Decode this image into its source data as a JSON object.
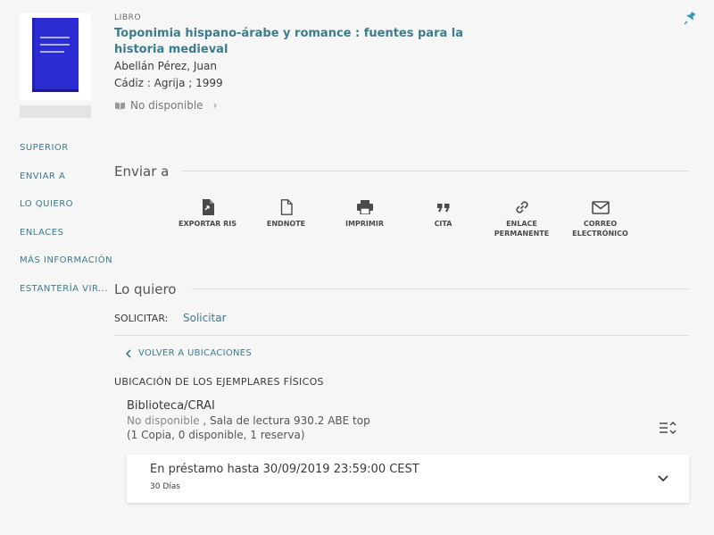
{
  "record": {
    "type": "Libro",
    "title": "Toponimia hispano-árabe y romance : fuentes para la historia medieval",
    "author": "Abellán Pérez, Juan",
    "publisher": "Cádiz : Agrija ; 1999",
    "availability": "No disponible",
    "cover_color": "#2a2bd1"
  },
  "nav": {
    "items": [
      "SUPERIOR",
      "ENVIAR A",
      "LO QUIERO",
      "ENLACES",
      "MÁS INFORMACIÓN",
      "ESTANTERÍA VIR..."
    ]
  },
  "send_to": {
    "title": "Enviar a",
    "actions": [
      {
        "label": "EXPORTAR RIS",
        "icon": "file-export-icon"
      },
      {
        "label": "ENDNOTE",
        "icon": "document-icon"
      },
      {
        "label": "IMPRIMIR",
        "icon": "printer-icon"
      },
      {
        "label": "CITA",
        "icon": "quote-icon"
      },
      {
        "label": "ENLACE PERMANENTE",
        "icon": "link-icon"
      },
      {
        "label": "CORREO ELECTRÓNICO",
        "icon": "envelope-icon"
      }
    ]
  },
  "request": {
    "title": "Lo quiero",
    "label": "SOLICITAR:",
    "link": "Solicitar"
  },
  "locations": {
    "back": "VOLVER A UBICACIONES",
    "heading": "UBICACIÓN DE LOS EJEMPLARES FÍSICOS",
    "library": "Biblioteca/CRAI",
    "status": "No disponible",
    "location_detail": " , Sala de lectura 930.2 ABE top",
    "copies": "(1 Copia, 0 disponible, 1 reserva)",
    "item": {
      "loan": "En préstamo hasta 30/09/2019 23:59:00 CEST",
      "policy": "30 Días"
    }
  },
  "colors": {
    "accent": "#3b7c8e",
    "background": "#f6f6f6"
  }
}
